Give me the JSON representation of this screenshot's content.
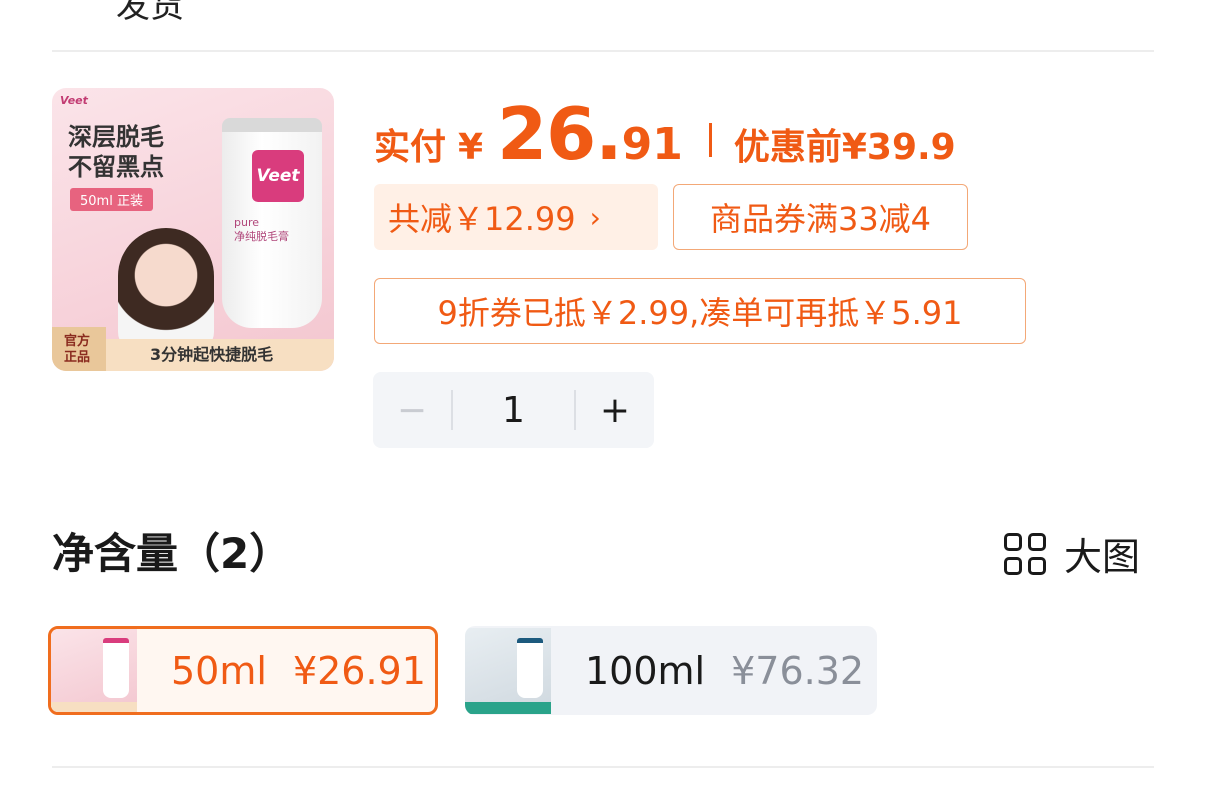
{
  "header": {
    "partial_label": "发货"
  },
  "product": {
    "thumb": {
      "logo_small": "Veet",
      "headline_line1": "深层脱毛",
      "headline_line2": "不留黑点",
      "tag": "50ml 正装",
      "brand": "Veet",
      "tube_text": "pure\n净纯脱毛膏",
      "badge": "官方\n正品",
      "slogan": "3分钟起快捷脱毛"
    },
    "price": {
      "paid_label": "实付",
      "currency": "¥",
      "integer": "26.",
      "decimal": "91",
      "before_label": "优惠前¥39.9"
    },
    "promos": {
      "total_off": "共减￥12.99",
      "total_off_arrow": "›",
      "coupon": "商品券满33减4",
      "discount": "9折券已抵￥2.99,凑单可再抵￥5.91"
    },
    "quantity": {
      "minus": "−",
      "value": "1",
      "plus": "+"
    }
  },
  "net_content": {
    "title": "净含量（2）",
    "bigview_label": "大图",
    "options": [
      {
        "size": "50ml",
        "price": "¥26.91",
        "selected": true
      },
      {
        "size": "100ml",
        "price": "¥76.32",
        "selected": false
      }
    ]
  },
  "colors": {
    "accent": "#f05a14",
    "accent_border": "#f3a877",
    "selected_border": "#f06d1e"
  }
}
